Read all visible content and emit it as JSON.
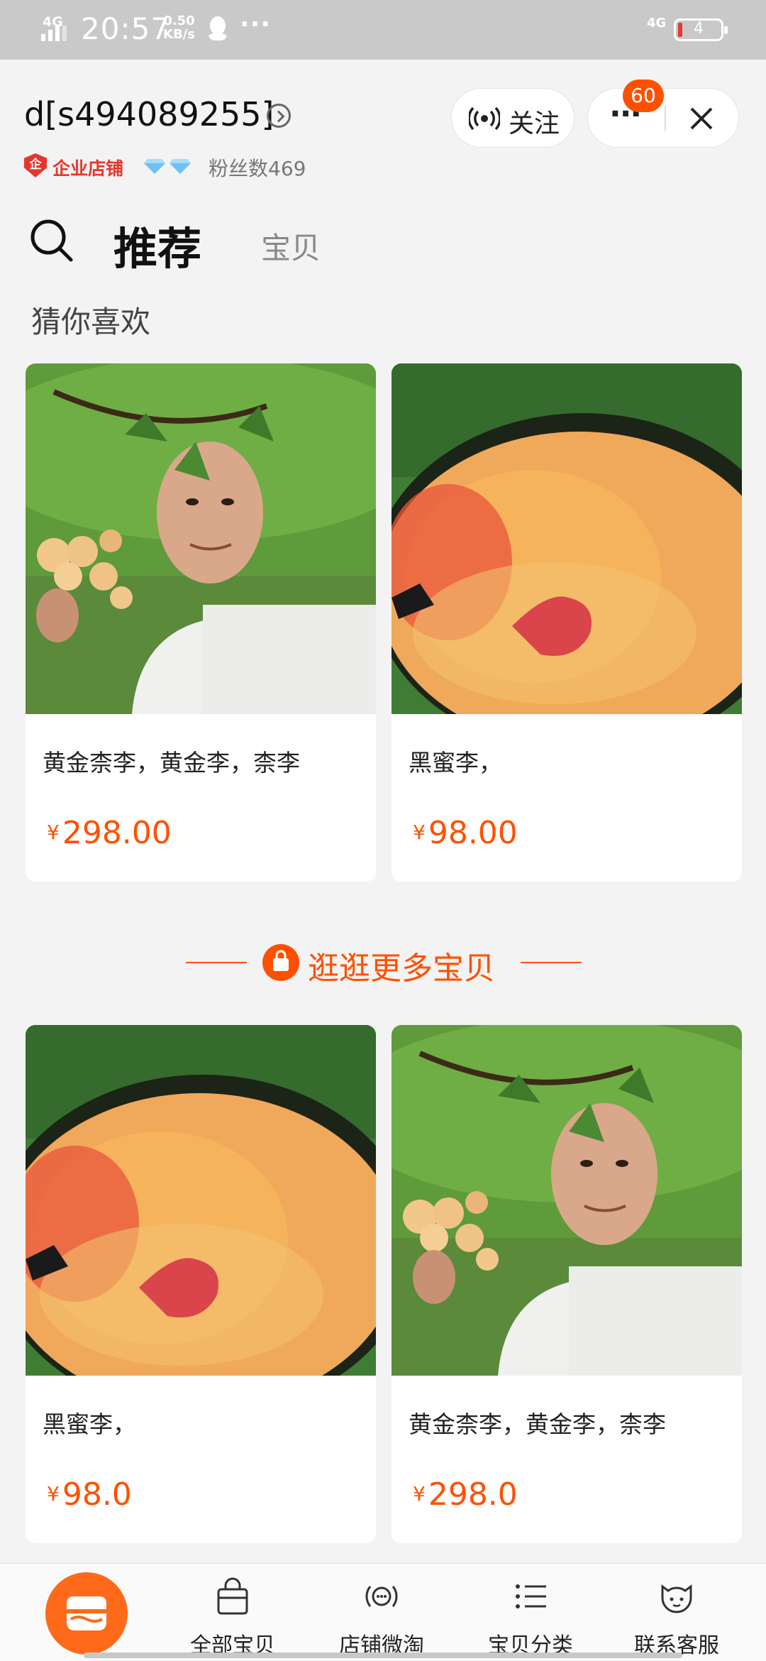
{
  "status_bar": {
    "network_left": "4G",
    "time": "20:57",
    "speed_value": "0.50",
    "speed_unit": "KB/s",
    "overflow": "···",
    "network_right": "4G",
    "battery": "4"
  },
  "shop": {
    "name": "d[s494089255]",
    "enterprise_icon": "企",
    "enterprise_label": "企业店铺",
    "fans": "粉丝数469",
    "follow_label": "关注",
    "more_label": "···",
    "notification_count": "60"
  },
  "tabs": {
    "recommended": "推荐",
    "items": "宝贝"
  },
  "section_title": "猜你喜欢",
  "products": [
    {
      "title": "黄金柰李，黄金李，柰李",
      "currency": "¥",
      "price": "298.00",
      "image": "farmer-plum-tree-photo"
    },
    {
      "title": "黑蜜李，",
      "currency": "¥",
      "price": "98.00",
      "image": "cut-plum-photo"
    },
    {
      "title": "黑蜜李，",
      "currency": "¥",
      "price": "98.0",
      "image": "cut-plum-photo"
    },
    {
      "title": "黄金柰李，黄金李，柰李",
      "currency": "¥",
      "price": "298.0",
      "image": "farmer-plum-tree-photo"
    }
  ],
  "more_products_label": "逛逛更多宝贝",
  "bottom_nav": [
    {
      "label": "全部宝贝",
      "icon": "shopping-bag-icon"
    },
    {
      "label": "店铺微淘",
      "icon": "broadcast-icon"
    },
    {
      "label": "宝贝分类",
      "icon": "list-icon"
    },
    {
      "label": "联系客服",
      "icon": "customer-service-icon"
    }
  ],
  "colors": {
    "accent": "#ff5000",
    "enterprise_red": "#e8352b",
    "status_bar": "#c9c9c9"
  }
}
